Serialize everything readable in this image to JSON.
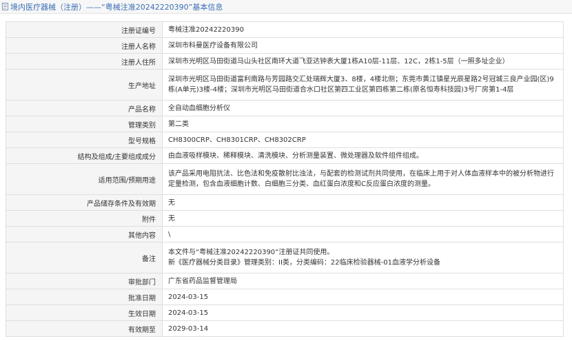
{
  "header": {
    "title": "境内医疗器械（注册）——“粤械注准20242220390”基本信息"
  },
  "rows": [
    {
      "label": "注册证编号",
      "value": "粤械注准20242220390"
    },
    {
      "label": "注册人名称",
      "value": "深圳市科曼医疗设备有限公司"
    },
    {
      "label": "注册人住所",
      "value": "深圳市光明区马田街道马山头社区南环大道飞亚达钟表大厦1栋A10层-11层、12C，2栋1-5层（一照多址企业）"
    },
    {
      "label": "生产地址",
      "value": "深圳市光明区马田街道富利南路与芳园路交汇处瑞辉大厦3、8楼，4楼北侧；东莞市黄江镇星光辰星路2号冠城三良产业园(区)9栋(A单元)3楼-4楼；深圳市光明区马田街道合水口社区第四工业区第四栋第二栋(原名恒寿科技园)3号厂房第1-4层"
    },
    {
      "label": "产品名称",
      "value": "全自动血细胞分析仪"
    },
    {
      "label": "管理类别",
      "value": "第二类"
    },
    {
      "label": "型号规格",
      "value": "CH8300CRP、CH8301CRP、CH8302CRP"
    },
    {
      "label": "结构及组成/主要组成成分",
      "value": "由血液吸样模块、稀释模块、清洗模块、分析测量装置、微处理器及软件组件组成。"
    },
    {
      "label": "适用范围/预期用途",
      "value": "该产品采用电阻抗法、比色法和免疫散射比浊法，与配套的检测试剂共同使用，在临床上用于对人体血液样本中的被分析物进行定量检测，包含血液细胞计数、白细胞三分类、血红蛋白浓度和C反应蛋白浓度的测量。"
    },
    {
      "label": "产品储存条件及有效期",
      "value": "无"
    },
    {
      "label": "附件",
      "value": "无"
    },
    {
      "label": "其他内容",
      "value": "\\"
    },
    {
      "label": "备注",
      "value_lines": [
        "本文件与“粤械注准20242220390”注册证共同使用。",
        "新《医疗器械分类目录》管理类别：II类，分类编码：22临床检验器械-01血液学分析设备"
      ]
    },
    {
      "label": "审批部门",
      "value": "广东省药品监督管理局"
    },
    {
      "label": "批准日期",
      "value": "2024-03-15"
    },
    {
      "label": "生效日期",
      "value": "2024-03-15"
    },
    {
      "label": "有效期至",
      "value": "2029-03-14"
    }
  ]
}
